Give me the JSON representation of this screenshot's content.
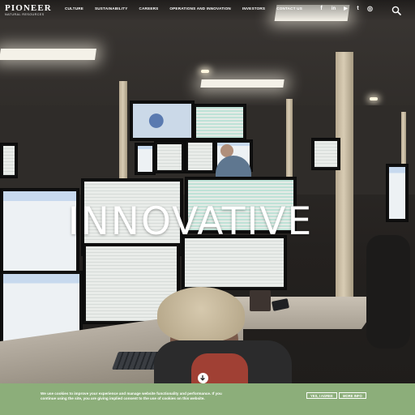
{
  "logo": {
    "main": "PIONEER",
    "sub": "NATURAL RESOURCES"
  },
  "nav": [
    {
      "label": "CULTURE"
    },
    {
      "label": "SUSTAINABILITY"
    },
    {
      "label": "CAREERS"
    },
    {
      "label": "OPERATIONS AND INNOVATION"
    },
    {
      "label": "INVESTORS"
    },
    {
      "label": "CONTACT US"
    }
  ],
  "social": [
    {
      "name": "facebook-icon",
      "glyph": "f"
    },
    {
      "name": "linkedin-icon",
      "glyph": "in"
    },
    {
      "name": "youtube-icon",
      "glyph": "▶"
    },
    {
      "name": "twitter-icon",
      "glyph": "t"
    },
    {
      "name": "instagram-icon",
      "glyph": "◎"
    }
  ],
  "hero": {
    "headline": "INNOVATIVE"
  },
  "cookie": {
    "text": "We use cookies to improve your experience and manage website functionality and performance. If you continue using the site, you are giving implied consent to the use of cookies on this website.",
    "agree_label": "YES, I AGREE",
    "more_label": "MORE INFO"
  },
  "colors": {
    "cookie_bar": "#8cae7a",
    "nav_text": "#ffffff"
  }
}
